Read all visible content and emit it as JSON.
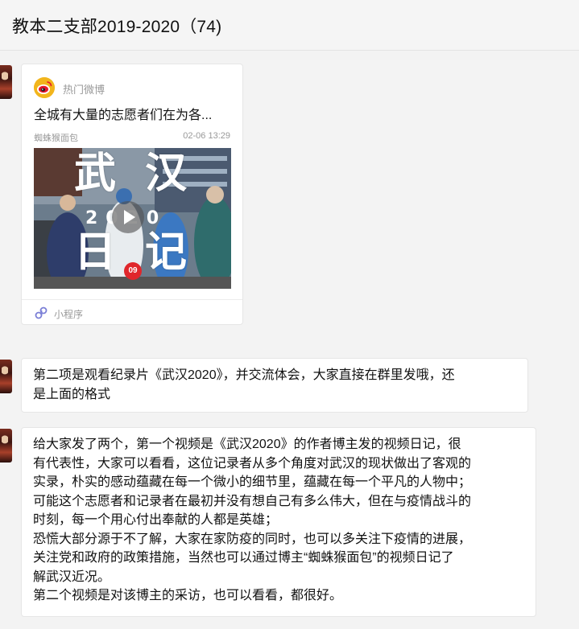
{
  "header": {
    "title": "教本二支部2019-2020（74)"
  },
  "mini_program_card": {
    "app_name": "热门微博",
    "title": "全城有大量的志愿者们在为各...",
    "author": "蜘蛛猴面包",
    "time": "02-06 13:29",
    "thumbnail": {
      "char_1": "武",
      "char_2": "汉",
      "char_3": "日",
      "char_4": "记",
      "year": "2020",
      "episode": "09"
    },
    "footer_label": "小程序"
  },
  "message_2": {
    "lines": [
      "第二项是观看纪录片《武汉2020》，并交流体会，大家直接在群里发哦，还",
      "是上面的格式"
    ]
  },
  "message_3": {
    "lines": [
      "给大家发了两个，第一个视频是《武汉2020》的作者博主发的视频日记，很",
      "有代表性，大家可以看看，这位记录者从多个角度对武汉的现状做出了客观的",
      "实录，朴实的感动蕴藏在每一个微小的细节里，蕴藏在每一个平凡的人物中；",
      "可能这个志愿者和记录者在最初并没有想自己有多么伟大，但在与疫情战斗的",
      "时刻，每一个用心付出奉献的人都是英雄；",
      "恐慌大部分源于不了解，大家在家防疫的同时，也可以多关注下疫情的进展，",
      "关注党和政府的政策措施，当然也可以通过博主“蜘蛛猴面包”的视频日记了",
      "解武汉近况。",
      "第二个视频是对该博主的采访，也可以看看，都很好。"
    ]
  },
  "colors": {
    "weibo_yellow": "#f2b51c",
    "weibo_red": "#e6162d",
    "episode_badge": "#e0262b",
    "muted_text": "#999999"
  },
  "icons": {
    "app_icon": "weibo-icon",
    "footer_icon": "mini-program-icon",
    "thumbnail_overlay": "play-icon"
  }
}
